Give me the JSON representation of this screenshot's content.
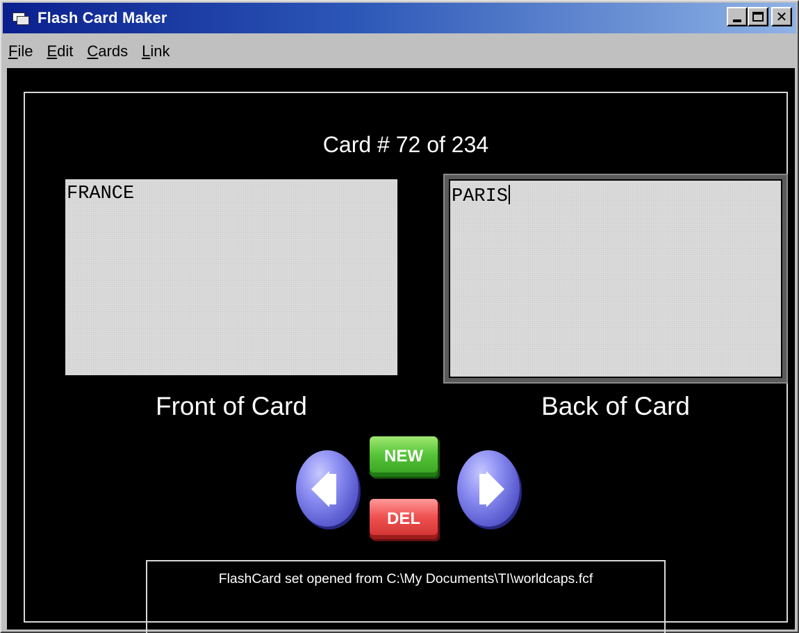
{
  "window": {
    "title": "Flash Card Maker",
    "controls": {
      "minimize": "minimize-icon",
      "maximize": "maximize-icon",
      "close": "✕"
    }
  },
  "menu": {
    "items": [
      {
        "label_first": "F",
        "label_rest": "ile"
      },
      {
        "label_first": "E",
        "label_rest": "dit"
      },
      {
        "label_first": "C",
        "label_rest": "ards"
      },
      {
        "label_first": "L",
        "label_rest": "ink"
      }
    ]
  },
  "card": {
    "counter": "Card # 72 of 234",
    "front_text": "FRANCE",
    "back_text": "PARIS",
    "front_caption": "Front of Card",
    "back_caption": "Back of Card"
  },
  "buttons": {
    "new_label": "NEW",
    "del_label": "DEL",
    "prev_icon": "left-arrow-icon",
    "next_icon": "right-arrow-icon"
  },
  "status": {
    "message": "FlashCard set opened from C:\\My Documents\\TI\\worldcaps.fcf"
  },
  "colors": {
    "titlebar_start": "#0a1f8e",
    "titlebar_end": "#8fb3e6",
    "client_bg": "#000000",
    "new_button": "#58c43a",
    "del_button": "#ef5050",
    "nav_button": "#8c8ef2"
  }
}
